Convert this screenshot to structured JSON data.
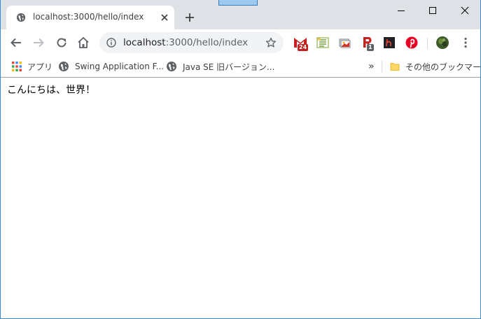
{
  "tab": {
    "title": "localhost:3000/hello/index"
  },
  "omnibox": {
    "url_host": "localhost",
    "url_path": ":3000/hello/index"
  },
  "extensions": {
    "gmail_badge": "24",
    "r_badge": "1"
  },
  "bookmarks": {
    "items": [
      {
        "label": "アプリ",
        "icon": "apps-grid-icon"
      },
      {
        "label": "Swing Application F...",
        "icon": "globe-icon"
      },
      {
        "label": "Java SE 旧バージョン...",
        "icon": "globe-icon"
      }
    ],
    "overflow": "»",
    "other_folder": "その他のブックマーク"
  },
  "page": {
    "body_text": "こんにちは、世界！"
  },
  "colors": {
    "tabstrip_bg": "#dee1e6",
    "omnibox_bg": "#f1f3f4",
    "gmail_red": "#c5221f",
    "pinterest_red": "#e60023"
  }
}
